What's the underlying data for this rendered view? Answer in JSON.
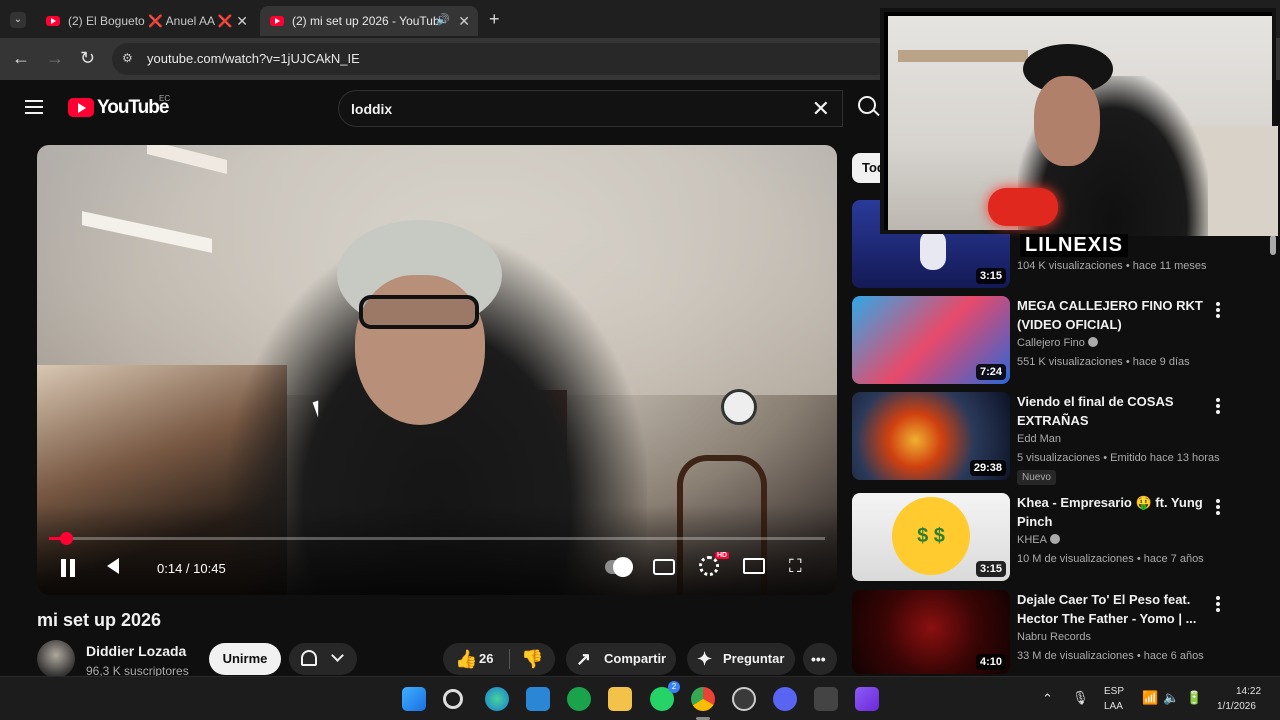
{
  "browser": {
    "tabs": [
      {
        "label": "(2) El Bogueto ❌ Anuel AA ❌",
        "active": false
      },
      {
        "label": "(2) mi set up 2026 - YouTub",
        "active": true
      }
    ],
    "url": "youtube.com/watch?v=1jUJCAkN_IE"
  },
  "youtube": {
    "logo_text": "YouTube",
    "country_code": "EC",
    "search_query": "loddix"
  },
  "player": {
    "time_display": "0:14 / 10:45",
    "progress": 0.022,
    "hd_badge": "HD"
  },
  "video": {
    "title": "mi set up 2026",
    "channel": "Diddier Lozada",
    "subscribers": "96,3 K suscriptores",
    "join_label": "Unirme",
    "likes": "26",
    "share_label": "Compartir",
    "ask_label": "Preguntar"
  },
  "sidebar": {
    "chip_label": "Todos",
    "items": [
      {
        "title": "",
        "channel": "",
        "meta": "104 K visualizaciones • hace 11 meses",
        "duration": "3:15"
      },
      {
        "title": "MEGA CALLEJERO FINO RKT (VIDEO OFICIAL)",
        "channel": "Callejero Fino",
        "meta": "551 K visualizaciones • hace 9 días",
        "duration": "7:24"
      },
      {
        "title": "Viendo el final de COSAS EXTRAÑAS",
        "channel": "Edd Man",
        "meta": "5 visualizaciones • Emitido hace 13 horas",
        "badge": "Nuevo",
        "duration": "29:38"
      },
      {
        "title": "Khea - Empresario 🤑 ft. Yung Pinch",
        "channel": "KHEA",
        "meta": "10 M de visualizaciones • hace 7 años",
        "duration": "3:15"
      },
      {
        "title": "Dejale Caer To' El Peso feat. Hector The Father - Yomo | ...",
        "channel": "Nabru Records",
        "meta": "33 M de visualizaciones • hace 6 años",
        "duration": "4:10"
      }
    ]
  },
  "overlay": {
    "streamer_name": "LILNEXIS"
  },
  "taskbar": {
    "language": "ESP",
    "layout": "LAA",
    "time": "14:22",
    "date": "1/1/2026",
    "whatsapp_badge": "2"
  },
  "colors": {
    "accent": "#ff0033",
    "background": "#0f0f0f",
    "tab_active": "#353535"
  }
}
